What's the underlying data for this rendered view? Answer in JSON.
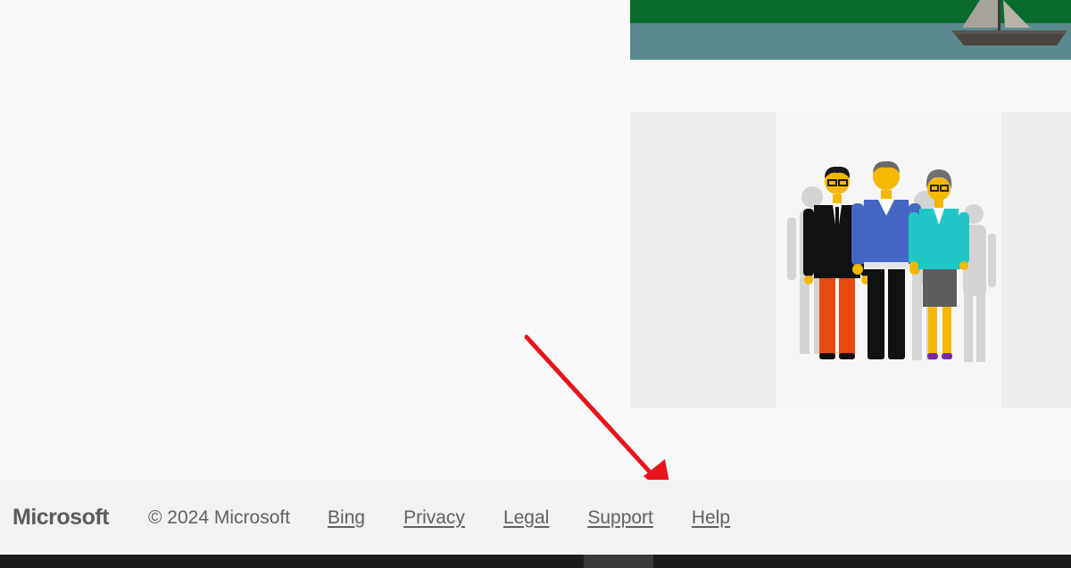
{
  "footer": {
    "brand": "Microsoft",
    "copyright": "© 2024 Microsoft",
    "links": [
      {
        "label": "Bing"
      },
      {
        "label": "Privacy"
      },
      {
        "label": "Legal"
      },
      {
        "label": "Support"
      },
      {
        "label": "Help"
      }
    ]
  },
  "colors": {
    "page_background": "#f9f9f9",
    "footer_background": "#f2f2f2",
    "footer_text": "#616161",
    "annotation_arrow": "#e8131b",
    "taskbar": "#1c1c1c"
  },
  "icons": {
    "lake_tile": "lake-boat-illustration",
    "people_tile": "people-group-illustration",
    "annotation": "red-arrow-icon"
  }
}
